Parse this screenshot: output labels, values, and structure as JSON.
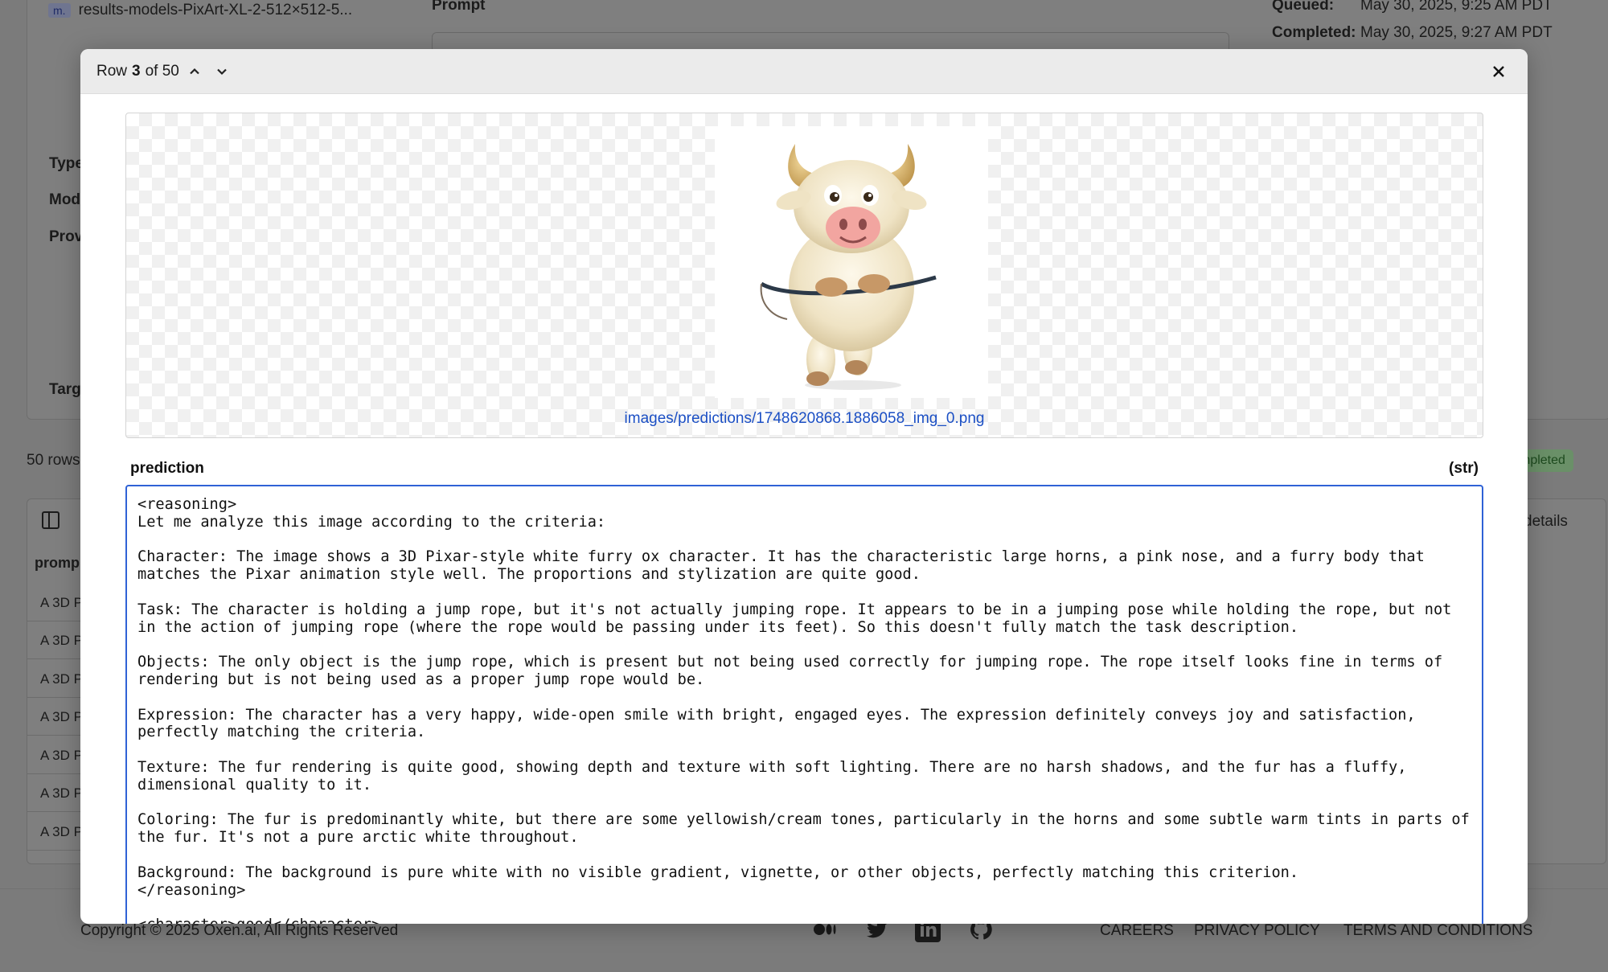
{
  "background": {
    "file_chip_tag": "m.",
    "file_name": "results-models-PixArt-XL-2-512×512-5...",
    "prompt_heading": "Prompt",
    "queued_label": "Queued:",
    "queued_value": "May 30, 2025, 9:25 AM PDT",
    "completed_label": "Completed:",
    "completed_value": "May 30, 2025, 9:27 AM PDT",
    "left_labels": [
      "Type",
      "Mod",
      "Prov",
      "Targ"
    ],
    "rows_count": "50 rows",
    "status_badge": "mpleted",
    "details_label": "details",
    "column_header": "promp",
    "row_prefixes": [
      "A 3D P",
      "A 3D P",
      "A 3D P",
      "A 3D P",
      "A 3D P",
      "A 3D P",
      "A 3D P"
    ],
    "footer": {
      "copyright": "Copyright © 2025 Oxen.ai, All Rights Reserved",
      "links": [
        "CAREERS",
        "PRIVACY POLICY",
        "TERMS AND CONDITIONS"
      ],
      "social_icons": [
        "medium-icon",
        "twitter-icon",
        "linkedin-icon",
        "github-icon"
      ]
    }
  },
  "modal": {
    "row_label": "Row",
    "row_current": "3",
    "row_of": "of 50",
    "image_path": "images/predictions/1748620868.1886058_img_0.png",
    "field_name": "prediction",
    "field_type": "(str)",
    "prediction_text": "<reasoning>\nLet me analyze this image according to the criteria:\n\nCharacter: The image shows a 3D Pixar-style white furry ox character. It has the characteristic large horns, a pink nose, and a furry body that\nmatches the Pixar animation style well. The proportions and stylization are quite good.\n\nTask: The character is holding a jump rope, but it's not actually jumping rope. It appears to be in a jumping pose while holding the rope, but not\nin the action of jumping rope (where the rope would be passing under its feet). So this doesn't fully match the task description.\n\nObjects: The only object is the jump rope, which is present but not being used correctly for jumping rope. The rope itself looks fine in terms of\nrendering but is not being used as a proper jump rope would be.\n\nExpression: The character has a very happy, wide-open smile with bright, engaged eyes. The expression definitely conveys joy and satisfaction,\nperfectly matching the criteria.\n\nTexture: The fur rendering is quite good, showing depth and texture with soft lighting. There are no harsh shadows, and the fur has a fluffy,\ndimensional quality to it.\n\nColoring: The fur is predominantly white, but there are some yellowish/cream tones, particularly in the horns and some subtle warm tints in parts of\nthe fur. It's not a pure arctic white throughout.\n\nBackground: The background is pure white with no visible gradient, vignette, or other objects, perfectly matching this criterion.\n</reasoning>\n\n<character>good</character>"
  },
  "colors": {
    "accent": "#2f62d6",
    "link": "#1b4fc4",
    "overlay": "#7b7b7b"
  }
}
